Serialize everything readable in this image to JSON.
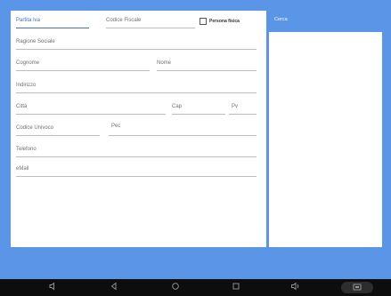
{
  "form": {
    "partita_iva_hint": "Partita Iva",
    "codice_fiscale_hint": "Codice Fiscale",
    "persona_fisica_label": "Persona fisica",
    "ragione_sociale_hint": "Ragione Sociale",
    "cognome_hint": "Cognome",
    "nome_hint": "Nome",
    "indirizzo_hint": "Indirizzo",
    "citta_hint": "Città",
    "cap_hint": "Cap",
    "pv_hint": "Pv",
    "codice_univoco_hint": "Codice Univoco",
    "pec_hint": "Pec",
    "telefono_hint": "Telefono",
    "email_hint": "eMail"
  },
  "search": {
    "label": "Cerca"
  },
  "navbar": {
    "volume_down_icon": "volume-down-icon",
    "back_icon": "back-icon",
    "home_icon": "home-icon",
    "recents_icon": "recents-icon",
    "volume_up_icon": "volume-up-icon",
    "screenshot_icon": "screenshot-icon"
  },
  "colors": {
    "accent": "#5b95e7",
    "active_field": "#3f6fbf",
    "nav_bar": "#0d0d0d"
  }
}
